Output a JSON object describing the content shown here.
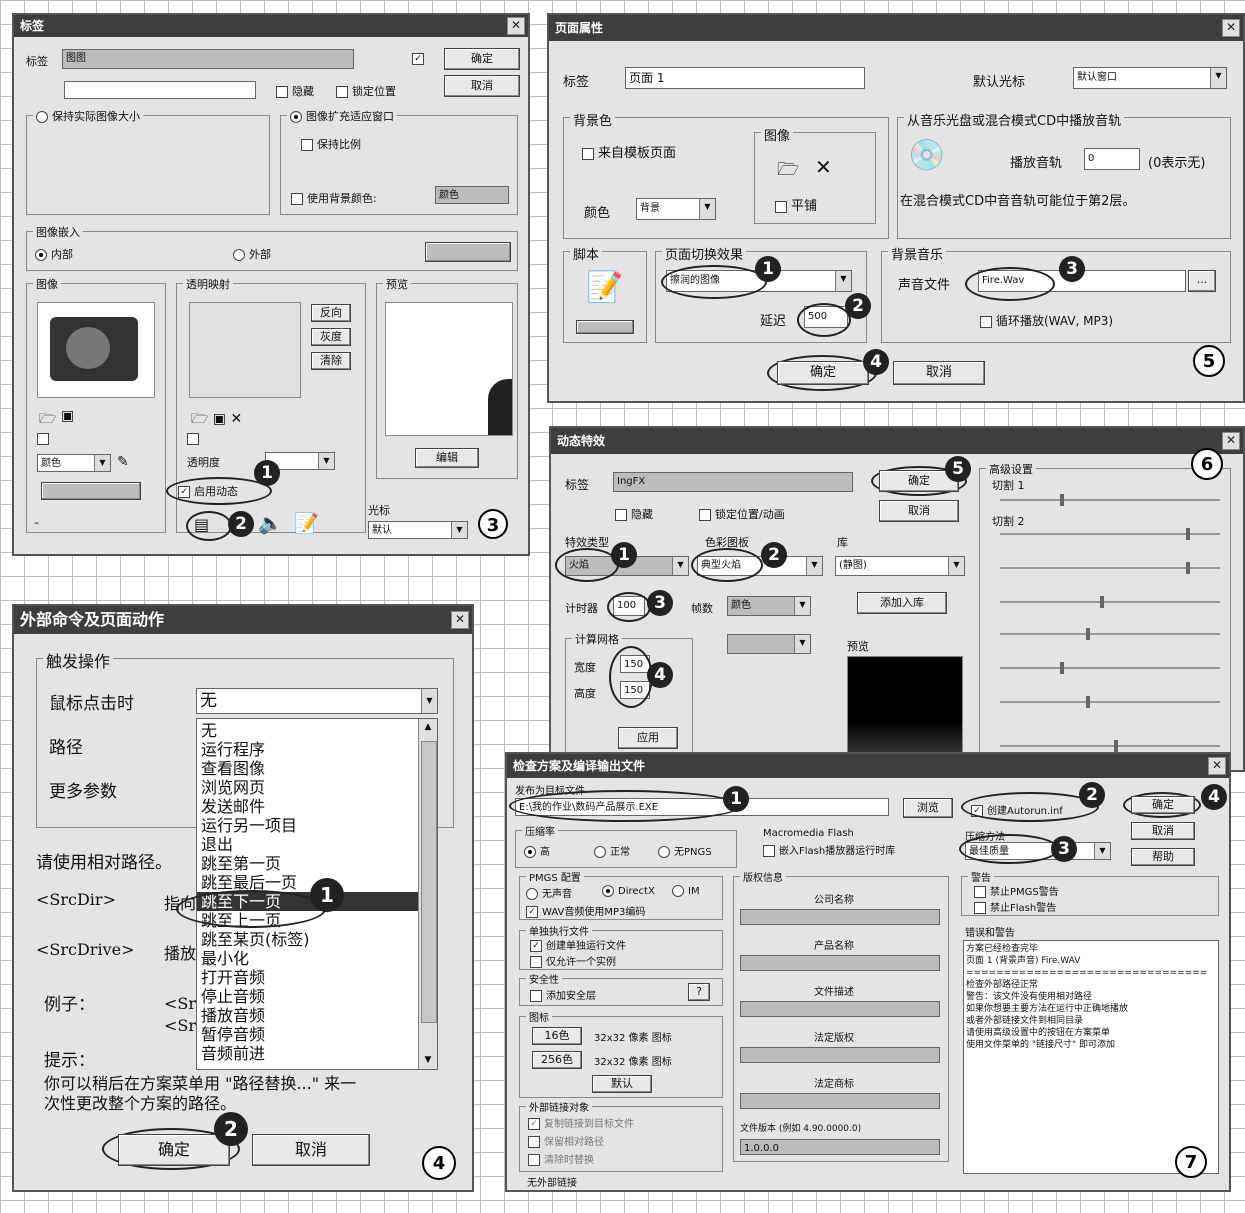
{
  "d3": {
    "title": "标签",
    "label": "标签",
    "label_value": "图图",
    "ok": "确定",
    "cancel": "取消",
    "hide": "隐藏",
    "lock_pos": "锁定位置",
    "keep_size": "保持实际图像大小",
    "expand_window": "图像扩充适应窗口",
    "keep_ratio": "保持比例",
    "use_bg_color": "使用背景颜色:",
    "embed": "图像嵌入",
    "embed_inside": "内部",
    "embed_outside": "外部",
    "image": "图像",
    "transparency": "透明映射",
    "preview": "预览",
    "enable_anim": "启用动态",
    "cursor": "光标",
    "cursor_value": "默认",
    "transparency_label": "透明度",
    "color_label": "颜色",
    "btn_up": "反向",
    "btn_down": "灰度",
    "btn_clear": "清除",
    "btn_edit": "编辑",
    "num": "3"
  },
  "d4": {
    "title": "外部命令及页面动作",
    "trigger": "触发操作",
    "on_click": "鼠标点击时",
    "on_click_value": "无",
    "path": "路径",
    "more": "更多参数",
    "note": "请使用相对路径。",
    "srcdir": "<SrcDir>",
    "srcdrive": "<SrcDrive>",
    "srcdir_desc": "指向",
    "srcdrive_desc": "播放",
    "example": "例子：",
    "ex1": "<Sr",
    "ex2": "<Sr",
    "hint": "提示：",
    "hint_text1": "你可以稍后在方案菜单用 \"路径替换...\" 来一",
    "hint_text2": "次性更改整个方案的路径。",
    "ok": "确定",
    "cancel": "取消",
    "options": [
      "无",
      "运行程序",
      "查看图像",
      "浏览网页",
      "发送邮件",
      "运行另一项目",
      "退出",
      "跳至第一页",
      "跳至最后一页",
      "跳至下一页",
      "跳至上一页",
      "跳至某页(标签)",
      "最小化",
      "打开音频",
      "停止音频",
      "播放音频",
      "暂停音频",
      "音频前进"
    ],
    "selected_index": 9,
    "num": "4"
  },
  "d5": {
    "title": "页面属性",
    "label": "标签",
    "label_value": "页面 1",
    "default_cursor": "默认光标",
    "default_cursor_value": "默认窗口",
    "bg_color": "背景色",
    "from_master": "来自模板页面",
    "color": "颜色",
    "color_value": "背景",
    "image": "图像",
    "tile": "平铺",
    "cd_track": "从音乐光盘或混合模式CD中播放音轨",
    "play_track": "播放音轨",
    "track_value": "0",
    "track_hint": "(0表示无)",
    "cd_note": "在混合模式CD中音音轨可能位于第2层。",
    "script": "脚本",
    "transition": "页面切换效果",
    "transition_value": "擦润的图像",
    "delay": "延迟",
    "delay_value": "500",
    "bg_music": "背景音乐",
    "sound_file": "声音文件",
    "sound_value": "Fire.Wav",
    "loop": "循环播放(WAV, MP3)",
    "ok": "确定",
    "cancel": "取消",
    "num": "5"
  },
  "d6": {
    "title": "动态特效",
    "label": "标签",
    "label_value": "IngFX",
    "ok": "确定",
    "cancel": "取消",
    "hide": "隐藏",
    "lock": "锁定位置/动画",
    "advanced": "高级设置",
    "adv1": "切割 1",
    "adv2": "切割 2",
    "effect": "特效类型",
    "effect_value": "火焰",
    "palette": "色彩图板",
    "palette_value": "典型火焰",
    "lib": "库",
    "lib_value": "(静图)",
    "timer": "计时器",
    "timer_value": "100",
    "frames": "帧数",
    "frames_value": "颜色",
    "add_lib": "添加入库",
    "grid": "计算网格",
    "width": "宽度",
    "width_value": "150",
    "height": "高度",
    "height_value": "150",
    "apply": "应用",
    "preview": "预览",
    "num": "6"
  },
  "d7": {
    "title": "检查方案及编译输出文件",
    "output_file": "发布为目标文件",
    "output_path": "E:\\我的作业\\数码产品展示.EXE",
    "browse": "浏览",
    "create_autorun": "创建Autorun.inf",
    "ok": "确定",
    "cancel": "取消",
    "help": "帮助",
    "compress": "压缩率",
    "c_high": "高",
    "c_normal": "正常",
    "c_none": "无PNGS",
    "flash": "Macromedia Flash",
    "flash_opt": "嵌入Flash播放器运行时库",
    "compress_method": "压缩方法",
    "compress_value": "最佳质量",
    "pmgs": "PMGS 配置",
    "no_sound": "无声音",
    "directx": "DirectX",
    "dx_other": "IM",
    "codec": "WAV音频使用MP3编码",
    "single_exe": "单独执行文件",
    "create_single": "创建单独运行文件",
    "allow_one": "仅允许一个实例",
    "security": "安全性",
    "add_security": "添加安全层",
    "icons": "图标",
    "icon16": "16色",
    "icon256": "256色",
    "icon_size1": "32x32 像素 图标",
    "icon_size2": "32x32 像素 图标",
    "default": "默认",
    "ext_objects": "外部链接对象",
    "ext1": "复制链接到目标文件",
    "ext2": "保留相对路径",
    "ext3": "清除时替换",
    "no_ext": "无外部链接",
    "version": "版权信息",
    "company": "公司名称",
    "product": "产品名称",
    "desc": "文件描述",
    "copyright": "法定版权",
    "trademark": "法定商标",
    "file_version": "文件版本 (例如 4.90.0000.0)",
    "file_version_value": "1.0.0.0",
    "warnings": "警告",
    "w1": "禁止PMGS警告",
    "w2": "禁止Flash警告",
    "errors": "错误和警告",
    "log": [
      "方案已经检查完毕",
      "页面 1  (背景声音)  Fire.WAV",
      "================================",
      "检查外部路径正常",
      "警告：该文件没有使用相对路径",
      "如果你想要主要方法在运行中正确地播放",
      "或者外部链接文件到相同目录",
      "请使用高级设置中的按钮在方案菜单",
      "使用文件菜单的 \"链接尺寸\" 即可添加"
    ],
    "num": "7"
  }
}
